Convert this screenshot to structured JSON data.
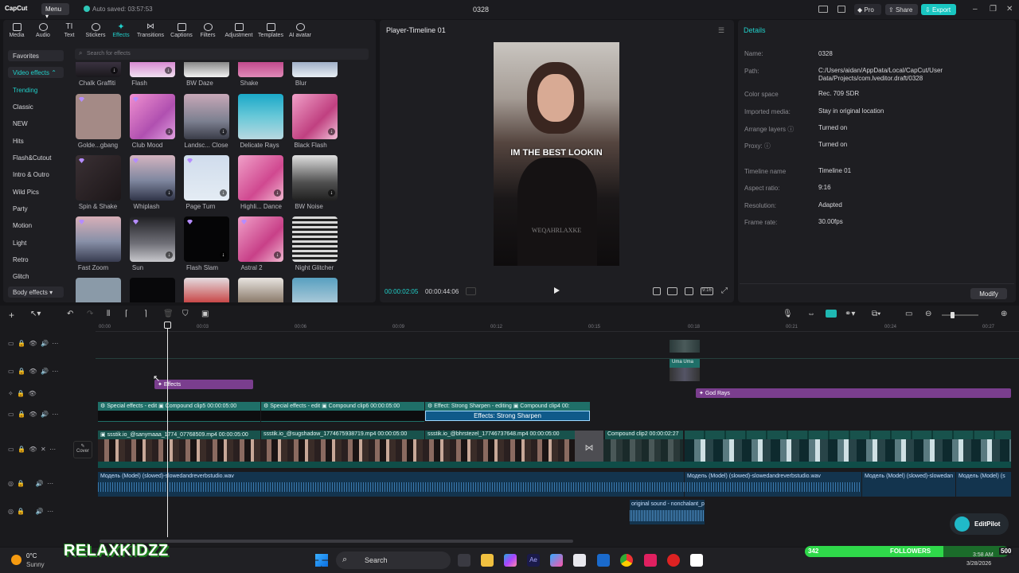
{
  "titlebar": {
    "app": "CapCut",
    "menu": "Menu",
    "autosave": "Auto saved: 03:57:53",
    "project": "0328",
    "pro": "Pro",
    "share": "Share",
    "export": "Export"
  },
  "toolbar": {
    "tabs": [
      "Media",
      "Audio",
      "Text",
      "Stickers",
      "Effects",
      "Transitions",
      "Captions",
      "Filters",
      "Adjustment",
      "Templates",
      "AI avatar"
    ],
    "active": "Effects"
  },
  "categories": {
    "favorites": "Favorites",
    "video_effects": "Video effects",
    "items": [
      "Trending",
      "Classic",
      "NEW",
      "Hits",
      "Flash&Cutout",
      "Intro & Outro",
      "Wild Pics",
      "Party",
      "Motion",
      "Light",
      "Retro",
      "Glitch"
    ],
    "body_effects": "Body effects"
  },
  "search": {
    "placeholder": "Search for effects"
  },
  "effects": {
    "row0": [
      "Chalk Graffiti",
      "Flash",
      "BW Daze",
      "Shake",
      "Blur"
    ],
    "row1": [
      "Golde...gbang",
      "Club Mood",
      "Landsc... Close",
      "Delicate Rays",
      "Black Flash"
    ],
    "row2": [
      "Spin & Shake",
      "Whiplash",
      "Page Turn",
      "Highli... Dance",
      "BW Noise"
    ],
    "row3": [
      "Fast Zoom",
      "Sun",
      "Flash Slam",
      "Astral 2",
      "Night Glitcher"
    ]
  },
  "player": {
    "title": "Player-Timeline 01",
    "caption": "IM THE BEST LOOKIN",
    "watermark": "WEQAHRLAXKE",
    "current": "00:00:02:05",
    "total": "00:00:44:06"
  },
  "details": {
    "title": "Details",
    "rows": [
      {
        "k": "Name:",
        "v": "0328"
      },
      {
        "k": "Path:",
        "v": "C:/Users/aidan/AppData/Local/CapCut/User Data/Projects/com.lveditor.draft/0328"
      },
      {
        "k": "Color space",
        "v": "Rec. 709 SDR"
      },
      {
        "k": "Imported media:",
        "v": "Stay in original location"
      },
      {
        "k": "Arrange layers ⓘ",
        "v": "Turned on"
      },
      {
        "k": "Proxy: ⓘ",
        "v": "Turned on"
      },
      {
        "k": "Timeline name",
        "v": "Timeline 01"
      },
      {
        "k": "Aspect ratio:",
        "v": "9:16"
      },
      {
        "k": "Resolution:",
        "v": "Adapted"
      },
      {
        "k": "Frame rate:",
        "v": "30.00fps"
      }
    ],
    "modify": "Modify"
  },
  "timeline": {
    "ticks": [
      "00:00",
      "00:03",
      "00:06",
      "00:09",
      "00:12",
      "00:15",
      "00:18",
      "00:21",
      "00:24",
      "00:27"
    ],
    "clips": {
      "effects": "Effects",
      "god_rays": "God Rays",
      "special1": "Special effects - edit",
      "compound1": "Compound clip5",
      "dur1": "00:00:05:00",
      "special2": "Special effects - edit",
      "compound2": "Compound clip6",
      "dur2": "00:00:05:00",
      "effect3": "Effect: Strong Sharpen - editing",
      "compound3": "Compound clip4",
      "dur3": "00:",
      "effects_bar": "Effects:  Strong Sharpen",
      "v1": "ssstik.io_@sanymaaa_1774_07768509.mp4",
      "v1d": "00:00:05:00",
      "v2": "ssstik.io_@sugshadow_1774675938719.mp4",
      "v2d": "00:00:05:00",
      "v3": "ssstik.io_@bhrstezel_17746737648.mp4",
      "v3d": "00:00:05:00",
      "v4": "Compound clip2",
      "v4d": "00:00:02:27",
      "cover": "Cover",
      "audio1": "Модель (Model) (slowed)-slowedandreverbstudio.wav",
      "audio2": "Модель (Model) (slowed)-slowedandreverbstudio.wav",
      "audio3": "Модель (Model) (slowed)-slowedan",
      "audio4": "Модель (Model) (s",
      "audio5": "original sound - nonchalant_pe",
      "uma": "Uma"
    }
  },
  "editpilot": "EditPilot",
  "taskbar": {
    "temp": "0°C",
    "weather": "Sunny",
    "search": "Search",
    "time": "3:58 AM",
    "date": "3/28/2026"
  },
  "overlay": {
    "brand": "RELAXKIDZZ",
    "followers_label": "FOLLOWERS",
    "followers_count": "342",
    "followers_goal": "500",
    "followers_progress": 0.68
  }
}
